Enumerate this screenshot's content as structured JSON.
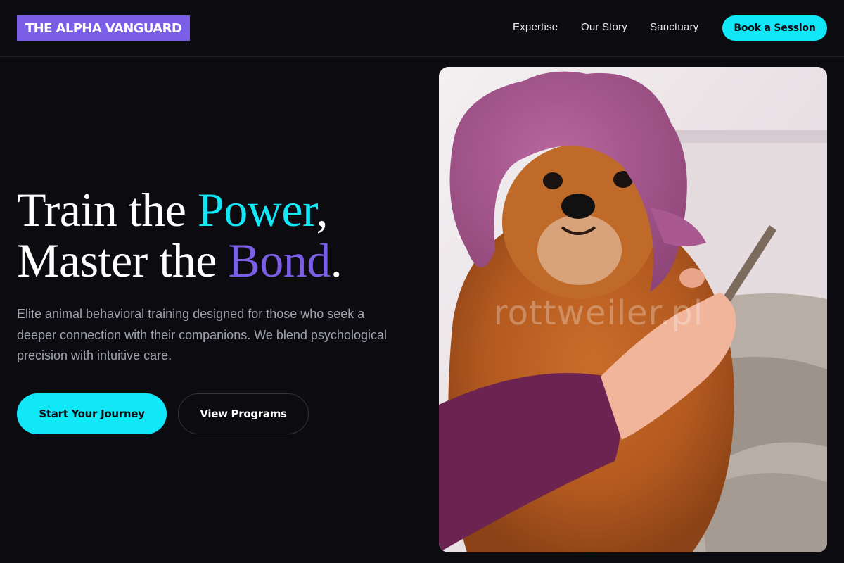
{
  "header": {
    "logo": "THE ALPHA VANGUARD",
    "nav": [
      "Expertise",
      "Our Story",
      "Sanctuary"
    ],
    "cta": "Book a Session"
  },
  "hero": {
    "line1_prefix": "Train the ",
    "line1_accent": "Power",
    "line1_suffix": ",",
    "line2_prefix": "Master the ",
    "line2_accent": "Bond",
    "line2_suffix": ".",
    "subtitle": "Elite animal behavioral training designed for those who seek a deeper connection with their companions. We blend psychological precision with intuitive care.",
    "primary_button": "Start Your Journey",
    "secondary_button": "View Programs"
  },
  "image": {
    "watermark": "rottweiler.pl"
  },
  "colors": {
    "background": "#0b0b10",
    "accent_cyan": "#10e8f8",
    "accent_purple": "#7a5fe6",
    "muted_text": "#a0a3ad"
  }
}
